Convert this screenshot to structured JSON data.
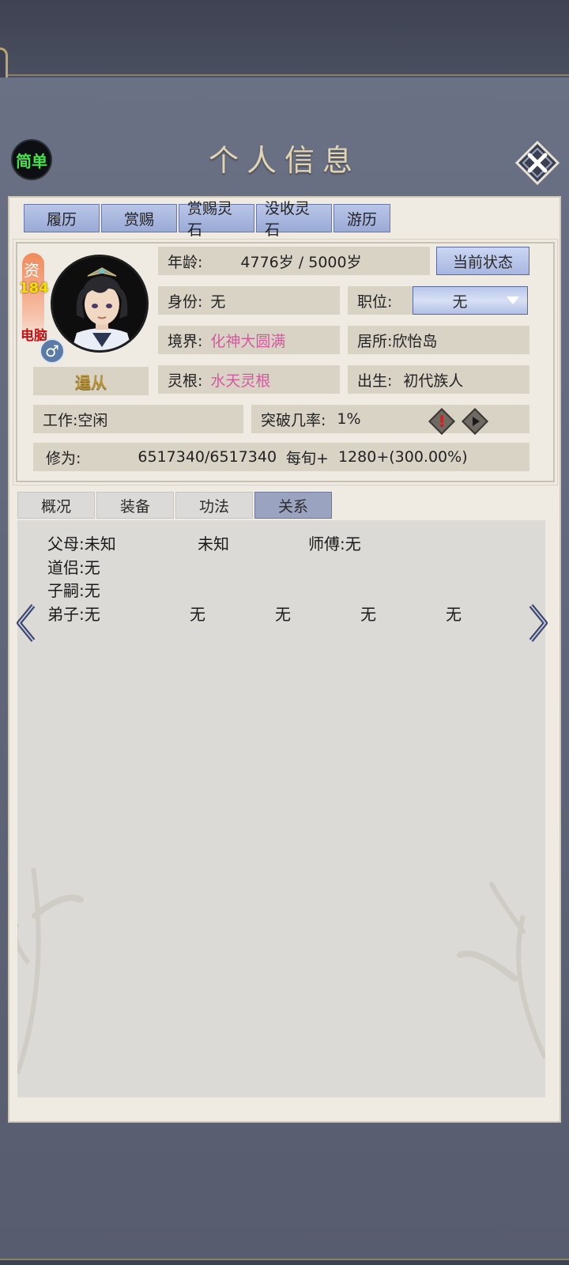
{
  "header": {
    "title": "个人信息",
    "simple_button": "简单"
  },
  "tabs_top": [
    "履历",
    "赏赐",
    "赏赐灵石",
    "没收灵石",
    "游历"
  ],
  "profile": {
    "zi_label": "资",
    "zi_value": "184",
    "pc_label": "电脑",
    "gender_symbol": "♂",
    "follow_button": "逞从"
  },
  "info": {
    "age_label": "年龄:",
    "age_value": "4776岁 / 5000岁",
    "status_button": "当前状态",
    "identity_label": "身份:",
    "identity_value": "无",
    "position_label": "职位:",
    "position_value": "无",
    "realm_label": "境界:",
    "realm_value": "化神大圆满",
    "residence_label": "居所:",
    "residence_value": "欣怡岛",
    "root_label": "灵根:",
    "root_value": "水天灵根",
    "birth_label": "出生:",
    "birth_value": "初代族人",
    "work_label": "工作:",
    "work_value": "空闲",
    "breakthrough_label": "突破几率:",
    "breakthrough_value": "1%",
    "cultivation_label": "修为:",
    "cultivation_value": "6517340/6517340",
    "per_period_label": "每旬+",
    "per_period_value": "1280+(300.00%)"
  },
  "tabs_mid": [
    {
      "label": "概况",
      "active": false
    },
    {
      "label": "装备",
      "active": false
    },
    {
      "label": "功法",
      "active": false
    },
    {
      "label": "关系",
      "active": true
    }
  ],
  "relations": {
    "parents_label": "父母:",
    "parent1": "未知",
    "parent2": "未知",
    "master_label": "师傅:",
    "master_value": "无",
    "partner_label": "道侣:",
    "partner_value": "无",
    "children_label": "子嗣:",
    "children_value": "无",
    "disciples_label": "弟子:",
    "disciples": [
      "无",
      "无",
      "无",
      "无",
      "无"
    ]
  },
  "colors": {
    "accent_pink": "#d45a9e",
    "tab_blue": "#a8b7e2",
    "green_text": "#45e04a"
  },
  "icons": {
    "close": "close-icon",
    "alert": "alert-icon",
    "play": "play-icon",
    "prev": "chevron-left-icon",
    "next": "chevron-right-icon"
  }
}
